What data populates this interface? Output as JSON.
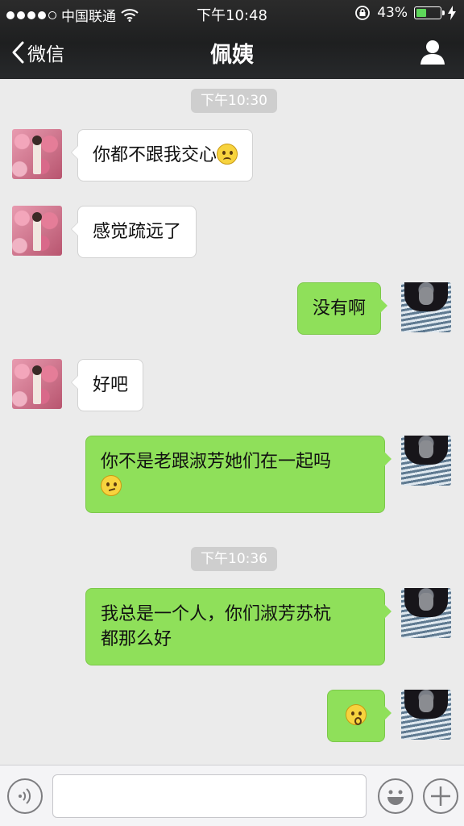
{
  "status_bar": {
    "carrier": "中国联通",
    "time": "下午10:48",
    "battery_percent": "43%",
    "battery_level": 0.43,
    "signal_dots": 4,
    "icons": [
      "wifi-icon",
      "rotation-lock-icon",
      "battery-icon",
      "charging-bolt-icon"
    ]
  },
  "nav": {
    "back_label": "微信",
    "title": "佩姨"
  },
  "timestamps": [
    "下午10:30",
    "下午10:36"
  ],
  "messages": [
    {
      "side": "left",
      "text": "你都不跟我交心",
      "emoji": "sad-emoji"
    },
    {
      "side": "left",
      "text": "感觉疏远了"
    },
    {
      "side": "right",
      "text": "没有啊"
    },
    {
      "side": "left",
      "text": "好吧"
    },
    {
      "side": "right",
      "text": "你不是老跟淑芳她们在一起吗",
      "emoji": "hmm-emoji"
    },
    {
      "side": "right",
      "text_line1": "我总是一个人，你们淑芳苏杭",
      "text_line2": "都那么好"
    },
    {
      "side": "right",
      "emoji": "surprised-emoji"
    }
  ],
  "colors": {
    "header_bg": "#1f2021",
    "chat_bg": "#ebebeb",
    "bubble_right": "#8fe05a",
    "bubble_left": "#ffffff",
    "timestamp_bg": "#cecece"
  },
  "input": {
    "value": "",
    "icons": [
      "voice-icon",
      "emoji-icon",
      "plus-icon"
    ]
  }
}
